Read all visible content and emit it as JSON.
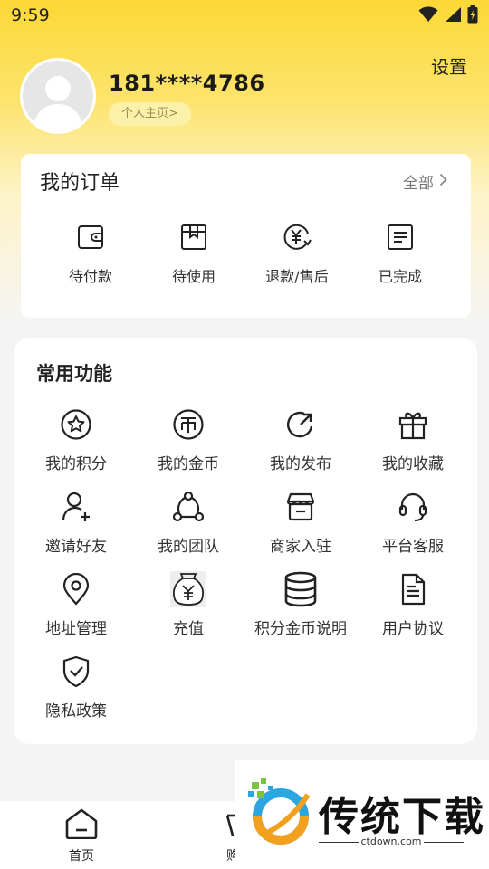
{
  "status_bar": {
    "time": "9:59"
  },
  "profile": {
    "phone": "181****4786",
    "homepage_label": "个人主页>",
    "settings_label": "设置"
  },
  "orders": {
    "title": "我的订单",
    "all_label": "全部",
    "items": [
      {
        "label": "待付款",
        "icon": "wallet-icon"
      },
      {
        "label": "待使用",
        "icon": "box-icon"
      },
      {
        "label": "退款/售后",
        "icon": "yen-refund-icon"
      },
      {
        "label": "已完成",
        "icon": "document-icon"
      }
    ]
  },
  "functions": {
    "title": "常用功能",
    "items": [
      {
        "label": "我的积分",
        "icon": "star-circle-icon"
      },
      {
        "label": "我的金币",
        "icon": "coin-icon"
      },
      {
        "label": "我的发布",
        "icon": "refresh-arrow-icon"
      },
      {
        "label": "我的收藏",
        "icon": "gift-icon"
      },
      {
        "label": "邀请好友",
        "icon": "add-user-icon"
      },
      {
        "label": "我的团队",
        "icon": "team-nodes-icon"
      },
      {
        "label": "商家入驻",
        "icon": "shop-icon"
      },
      {
        "label": "平台客服",
        "icon": "headset-icon"
      },
      {
        "label": "地址管理",
        "icon": "location-pin-icon"
      },
      {
        "label": "充值",
        "icon": "money-bag-icon"
      },
      {
        "label": "积分金币说明",
        "icon": "database-icon"
      },
      {
        "label": "用户协议",
        "icon": "file-text-icon"
      },
      {
        "label": "隐私政策",
        "icon": "shield-check-icon"
      }
    ]
  },
  "bottom_nav": {
    "home_label": "首页",
    "cart_label": "购"
  },
  "watermark": {
    "text": "传统下载",
    "url": "ctdown.com"
  }
}
